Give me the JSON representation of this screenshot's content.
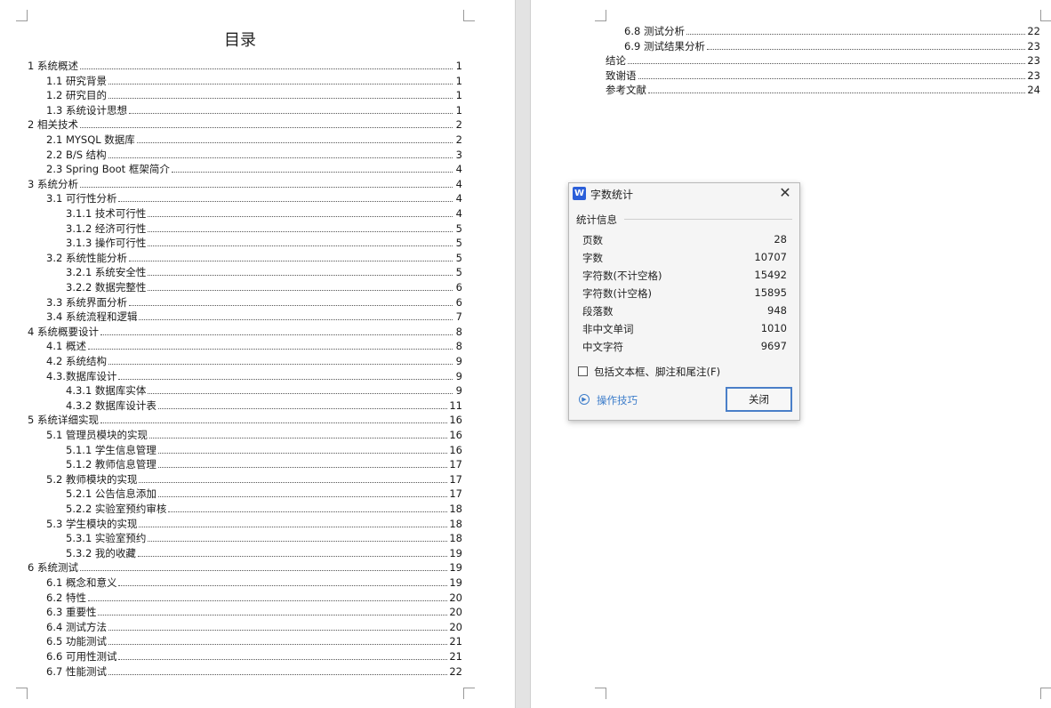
{
  "toc": {
    "title": "目录",
    "left": [
      {
        "label": "1 系统概述",
        "page": "1",
        "level": 1
      },
      {
        "label": "1.1 研究背景",
        "page": "1",
        "level": 2
      },
      {
        "label": "1.2 研究目的",
        "page": "1",
        "level": 2
      },
      {
        "label": "1.3 系统设计思想",
        "page": "1",
        "level": 2
      },
      {
        "label": "2 相关技术",
        "page": "2",
        "level": 1
      },
      {
        "label": "2.1 MYSQL 数据库",
        "page": "2",
        "level": 2
      },
      {
        "label": "2.2 B/S 结构",
        "page": "3",
        "level": 2
      },
      {
        "label": "2.3 Spring Boot 框架简介",
        "page": "4",
        "level": 2
      },
      {
        "label": "3 系统分析",
        "page": "4",
        "level": 1
      },
      {
        "label": "3.1 可行性分析",
        "page": "4",
        "level": 2
      },
      {
        "label": "3.1.1 技术可行性",
        "page": "4",
        "level": 3
      },
      {
        "label": "3.1.2 经济可行性",
        "page": "5",
        "level": 3
      },
      {
        "label": "3.1.3 操作可行性",
        "page": "5",
        "level": 3
      },
      {
        "label": "3.2 系统性能分析",
        "page": "5",
        "level": 2
      },
      {
        "label": "3.2.1 系统安全性",
        "page": "5",
        "level": 3
      },
      {
        "label": "3.2.2 数据完整性",
        "page": "6",
        "level": 3
      },
      {
        "label": "3.3 系统界面分析",
        "page": "6",
        "level": 2
      },
      {
        "label": "3.4 系统流程和逻辑",
        "page": "7",
        "level": 2
      },
      {
        "label": "4 系统概要设计",
        "page": "8",
        "level": 1
      },
      {
        "label": "4.1 概述",
        "page": "8",
        "level": 2
      },
      {
        "label": "4.2 系统结构",
        "page": "9",
        "level": 2
      },
      {
        "label": "4.3.数据库设计",
        "page": "9",
        "level": 2
      },
      {
        "label": "4.3.1 数据库实体",
        "page": "9",
        "level": 3
      },
      {
        "label": "4.3.2 数据库设计表",
        "page": "11",
        "level": 3
      },
      {
        "label": "5 系统详细实现",
        "page": "16",
        "level": 1
      },
      {
        "label": "5.1 管理员模块的实现",
        "page": "16",
        "level": 2
      },
      {
        "label": "5.1.1 学生信息管理",
        "page": "16",
        "level": 3
      },
      {
        "label": "5.1.2 教师信息管理",
        "page": "17",
        "level": 3
      },
      {
        "label": "5.2 教师模块的实现",
        "page": "17",
        "level": 2
      },
      {
        "label": "5.2.1 公告信息添加",
        "page": "17",
        "level": 3
      },
      {
        "label": "5.2.2 实验室预约审核",
        "page": "18",
        "level": 3
      },
      {
        "label": "5.3 学生模块的实现",
        "page": "18",
        "level": 2
      },
      {
        "label": "5.3.1 实验室预约",
        "page": "18",
        "level": 3
      },
      {
        "label": "5.3.2 我的收藏",
        "page": "19",
        "level": 3
      },
      {
        "label": "6 系统测试",
        "page": "19",
        "level": 1
      },
      {
        "label": "6.1 概念和意义",
        "page": "19",
        "level": 2
      },
      {
        "label": "6.2 特性",
        "page": "20",
        "level": 2
      },
      {
        "label": "6.3 重要性",
        "page": "20",
        "level": 2
      },
      {
        "label": "6.4 测试方法",
        "page": "20",
        "level": 2
      },
      {
        "label": "6.5 功能测试",
        "page": "21",
        "level": 2
      },
      {
        "label": "6.6 可用性测试",
        "page": "21",
        "level": 2
      },
      {
        "label": "6.7 性能测试",
        "page": "22",
        "level": 2
      }
    ],
    "right": [
      {
        "label": "6.8 测试分析",
        "page": "22",
        "level": 2
      },
      {
        "label": "6.9 测试结果分析",
        "page": "23",
        "level": 2
      },
      {
        "label": "结论",
        "page": "23",
        "level": 1
      },
      {
        "label": "致谢语",
        "page": "23",
        "level": 1
      },
      {
        "label": "参考文献",
        "page": "24",
        "level": 1
      }
    ]
  },
  "dialog": {
    "title": "字数统计",
    "app_icon": "W",
    "app_icon_color": "#2b5fd9",
    "close_icon": "close-icon",
    "group_label": "统计信息",
    "stats": [
      {
        "key": "页数",
        "value": "28"
      },
      {
        "key": "字数",
        "value": "10707"
      },
      {
        "key": "字符数(不计空格)",
        "value": "15492"
      },
      {
        "key": "字符数(计空格)",
        "value": "15895"
      },
      {
        "key": "段落数",
        "value": "948"
      },
      {
        "key": "非中文单词",
        "value": "1010"
      },
      {
        "key": "中文字符",
        "value": "9697"
      }
    ],
    "include_checkbox_label": "包括文本框、脚注和尾注(F)",
    "include_checked": false,
    "tips_label": "操作技巧",
    "close_button_label": "关闭",
    "accent_color": "#4a7fc8"
  }
}
